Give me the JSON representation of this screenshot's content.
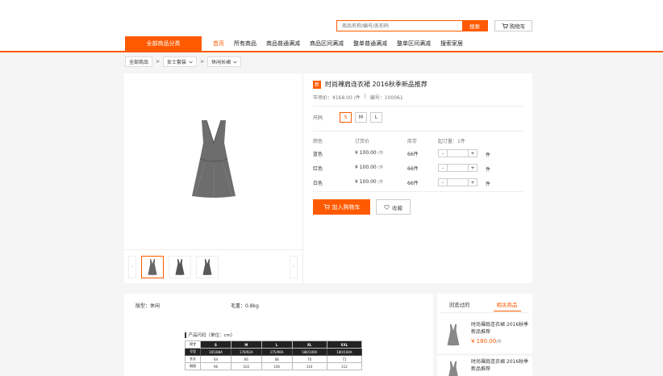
{
  "header": {
    "search_placeholder": "商品名称/编号/条形码",
    "search_button": "搜索",
    "cart_button": "购物车"
  },
  "nav": {
    "category_button": "全部商品分类",
    "items": [
      "首页",
      "所有商品",
      "商品普通满减",
      "商品区间满减",
      "整单普通满减",
      "整单区间满减",
      "搜索家居"
    ]
  },
  "breadcrumb": {
    "items": [
      "全部商品",
      "女士套装",
      "休闲长裙"
    ],
    "separator": ">"
  },
  "product": {
    "badge": "新",
    "title": "时尚裸肩连衣裙 2016秋季新品推荐",
    "market_price": "市场价：¥168.00 /件",
    "meta_separator": "|",
    "code": "编号：100061",
    "size_label": "尺码",
    "sizes": [
      "S",
      "M",
      "L"
    ],
    "selected_size": "S",
    "variant_headers": [
      "颜色",
      "订货价",
      "库存",
      "起订量：1件"
    ],
    "variants": [
      {
        "color": "蓝色",
        "price": "¥ 100.00",
        "unit": "/件",
        "stock": "66件",
        "qty_unit": "件"
      },
      {
        "color": "红色",
        "price": "¥ 100.00",
        "unit": "/件",
        "stock": "66件",
        "qty_unit": "件"
      },
      {
        "color": "白色",
        "price": "¥ 100.00",
        "unit": "/件",
        "stock": "66件",
        "qty_unit": "件"
      }
    ],
    "minus": "-",
    "plus": "+",
    "add_cart": "加入购物车",
    "favorite": "收藏",
    "thumb_prev": "‹",
    "thumb_next": "›"
  },
  "details": {
    "attr1": "版型：休闲",
    "attr2": "毛重：0.8kg",
    "size_table_title": "产品尺码（单位：cm）",
    "size_table": {
      "headers": [
        "尺寸",
        "S",
        "M",
        "L",
        "XL",
        "XXL"
      ],
      "rows": [
        [
          "号型",
          "165/88A",
          "170/92A",
          "175/96A",
          "180/100A",
          "180/104A"
        ],
        [
          "衣长",
          "64",
          "66",
          "68",
          "70",
          "71"
        ],
        [
          "胸围",
          "96",
          "102",
          "106",
          "110",
          "112"
        ]
      ]
    }
  },
  "sidebar": {
    "tabs": [
      "浏览过的",
      "相关商品"
    ],
    "active_tab": "相关商品",
    "items": [
      {
        "title": "时尚裸肩连衣裙 2016秋季新品推荐",
        "price": "¥ 180.00",
        "unit": "/件"
      },
      {
        "title": "时尚裸肩连衣裙 2016秋季新品推荐"
      }
    ]
  },
  "colors": {
    "accent": "#ff5a00"
  }
}
